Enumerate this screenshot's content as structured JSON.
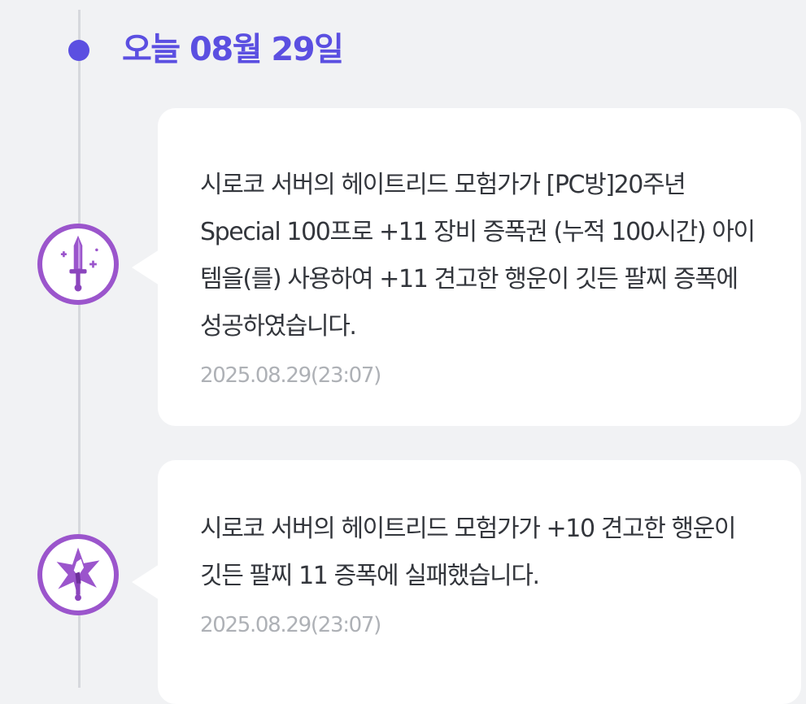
{
  "timeline": {
    "date_heading": "오늘 08월 29일",
    "accent_color": "#5b4fe1",
    "events": [
      {
        "icon": "sparkle-sword-icon",
        "result": "success",
        "message": "시로코 서버의 헤이트리드 모험가가 [PC방]20주년 Special 100프로 +11 장비 증폭권 (누적 100시간) 아이템을(를) 사용하여 +11 견고한 행운이 깃든 팔찌 증폭에 성공하였습니다.",
        "timestamp": "2025.08.29(23:07)"
      },
      {
        "icon": "broken-sword-icon",
        "result": "failure",
        "message": "시로코 서버의 헤이트리드 모험가가 +10 견고한 행운이 깃든 팔찌 11 증폭에 실패했습니다.",
        "timestamp": "2025.08.29(23:07)"
      }
    ]
  }
}
